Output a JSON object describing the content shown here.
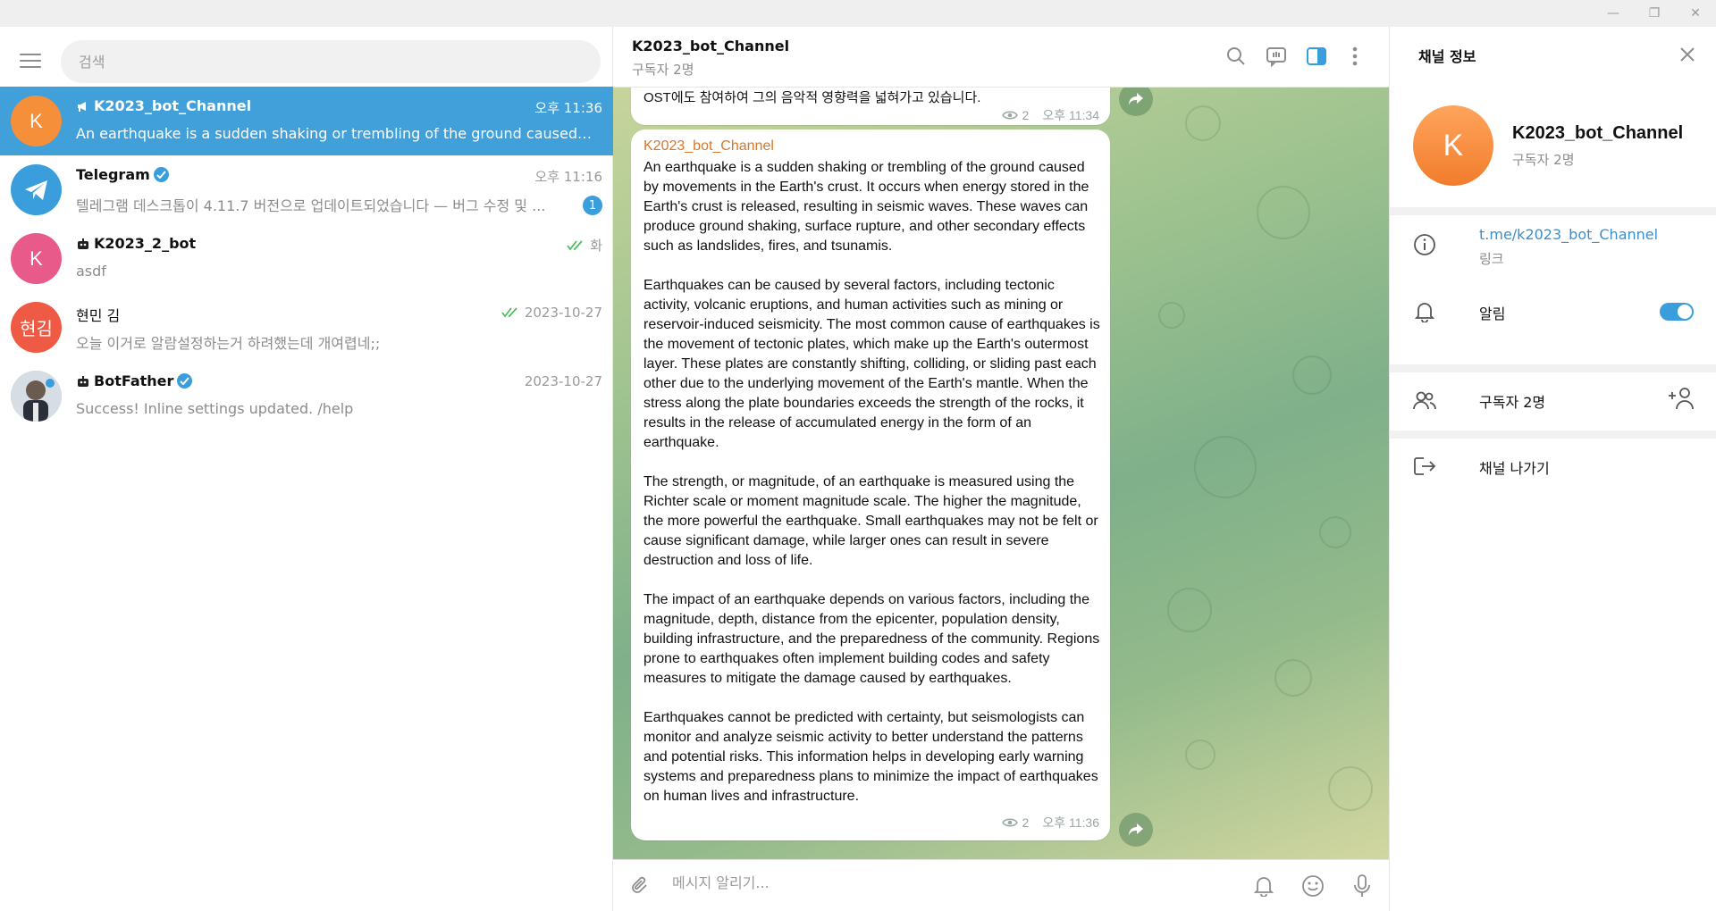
{
  "window": {
    "min_glyph": "—",
    "restore_glyph": "❐",
    "close_glyph": "✕"
  },
  "sidebar": {
    "search_placeholder": "검색",
    "chats": [
      {
        "name": "K2023_bot_Channel",
        "time": "오후 11:36",
        "preview": "An earthquake is a sudden shaking or trembling of the ground caused by m...",
        "avatar_letter": "K",
        "avatar_color": "#f58f3a",
        "active": true,
        "kind": "channel",
        "icon": "megaphone-icon"
      },
      {
        "name": "Telegram",
        "time": "오후 11:16",
        "preview": "텔레그램 데스크톱이 4.11.7 버전으로 업데이트되었습니다 — 버그 수정 및 ...",
        "avatar_color": "#3a9ddc",
        "verified": true,
        "unread": "1",
        "icon": "telegram-plane-icon"
      },
      {
        "name": "K2023_2_bot",
        "time": "화",
        "preview": "asdf",
        "avatar_letter": "K",
        "avatar_color": "#e85a8a",
        "kind": "bot",
        "icon": "bot-icon",
        "read": true
      },
      {
        "name": "현민 김",
        "time": "2023-10-27",
        "preview": "오늘 이거로 알람설정하는거 하려했는데 개여렵네;;",
        "avatar_letter": "현김",
        "avatar_color": "#ee5a44",
        "read": true
      },
      {
        "name": "BotFather",
        "time": "2023-10-27",
        "preview": "Success! Inline settings updated. /help",
        "verified": true,
        "kind": "bot",
        "icon": "bot-icon"
      }
    ]
  },
  "chat": {
    "title": "K2023_bot_Channel",
    "subtitle": "구독자 2명",
    "prev_message": {
      "text": "OST에도 참여하여 그의 음악적 영향력을 넓혀가고 있습니다.",
      "views": "2",
      "time": "오후 11:34"
    },
    "message": {
      "sender": "K2023_bot_Channel",
      "paragraphs": [
        "An earthquake is a sudden shaking or trembling of the ground caused by movements in the Earth's crust. It occurs when energy stored in the Earth's crust is released, resulting in seismic waves. These waves can produce ground shaking, surface rupture, and other secondary effects such as landslides, fires, and tsunamis.",
        "Earthquakes can be caused by several factors, including tectonic activity, volcanic eruptions, and human activities such as mining or reservoir-induced seismicity. The most common cause of earthquakes is the movement of tectonic plates, which make up the Earth's outermost layer. These plates are constantly shifting, colliding, or sliding past each other due to the underlying movement of the Earth's mantle. When the stress along the plate boundaries exceeds the strength of the rocks, it results in the release of accumulated energy in the form of an earthquake.",
        "The strength, or magnitude, of an earthquake is measured using the Richter scale or moment magnitude scale. The higher the magnitude, the more powerful the earthquake. Small earthquakes may not be felt or cause significant damage, while larger ones can result in severe destruction and loss of life.",
        "The impact of an earthquake depends on various factors, including the magnitude, depth, distance from the epicenter, population density, building infrastructure, and the preparedness of the community. Regions prone to earthquakes often implement building codes and safety measures to mitigate the damage caused by earthquakes.",
        "Earthquakes cannot be predicted with certainty, but seismologists can monitor and analyze seismic activity to better understand the patterns and potential risks. This information helps in developing early warning systems and preparedness plans to minimize the impact of earthquakes on human lives and infrastructure."
      ],
      "views": "2",
      "time": "오후 11:36"
    },
    "composer_placeholder": "메시지 알리기..."
  },
  "info_panel": {
    "title": "채널 정보",
    "name": "K2023_bot_Channel",
    "subscribers": "구독자 2명",
    "avatar_letter": "K",
    "link": "t.me/k2023_bot_Channel",
    "link_label": "링크",
    "notifications_label": "알림",
    "notifications_on": true,
    "subscribers_row": "구독자 2명",
    "leave_label": "채널 나가기"
  },
  "colors": {
    "accent": "#419fd9",
    "sender": "#d6782c",
    "link": "#3a8fce"
  }
}
